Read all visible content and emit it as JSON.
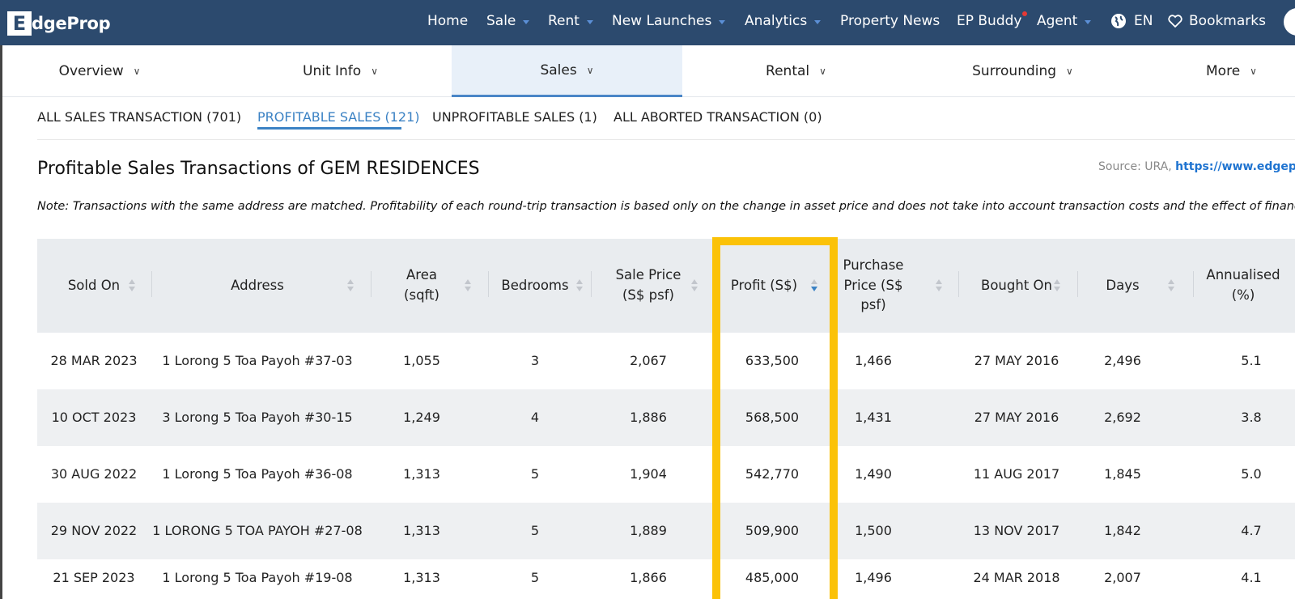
{
  "brand": {
    "logo_letter": "E",
    "logo_text": "dgeProp"
  },
  "topnav": {
    "items": [
      {
        "label": "Home"
      },
      {
        "label": "Sale"
      },
      {
        "label": "Rent"
      },
      {
        "label": "New Launches"
      },
      {
        "label": "Analytics"
      },
      {
        "label": "Property News"
      },
      {
        "label": "EP Buddy"
      },
      {
        "label": "Agent"
      },
      {
        "label": "EN"
      },
      {
        "label": "Bookmarks"
      }
    ]
  },
  "subtabs": [
    {
      "label": "Overview"
    },
    {
      "label": "Unit Info"
    },
    {
      "label": "Sales"
    },
    {
      "label": "Rental"
    },
    {
      "label": "Surrounding"
    },
    {
      "label": "More"
    }
  ],
  "transaction_tabs": [
    {
      "label": "ALL SALES TRANSACTION (701)"
    },
    {
      "label": "PROFITABLE SALES (121)"
    },
    {
      "label": "UNPROFITABLE SALES (1)"
    },
    {
      "label": "ALL ABORTED TRANSACTION (0)"
    }
  ],
  "heading": "Profitable Sales Transactions of GEM RESIDENCES",
  "source": {
    "prefix": "Source: URA,",
    "link": "https://www.edgepro"
  },
  "note": "Note: Transactions with the same address are matched. Profitability of each round-trip transaction is based only on the change in asset price and does not take into account transaction costs and the effect of financing.",
  "table": {
    "columns": [
      "Sold On",
      "Address",
      "Area (sqft)",
      "Bedrooms",
      "Sale Price (S$ psf)",
      "Profit (S$)",
      "Purchase Price (S$ psf)",
      "Bought On",
      "Days",
      "Annualised (%)"
    ],
    "rows": [
      [
        "28 MAR 2023",
        "1 Lorong 5 Toa Payoh #37-03",
        "1,055",
        "3",
        "2,067",
        "633,500",
        "1,466",
        "27 MAY 2016",
        "2,496",
        "5.1"
      ],
      [
        "10 OCT 2023",
        "3 Lorong 5 Toa Payoh #30-15",
        "1,249",
        "4",
        "1,886",
        "568,500",
        "1,431",
        "27 MAY 2016",
        "2,692",
        "3.8"
      ],
      [
        "30 AUG 2022",
        "1 Lorong 5 Toa Payoh #36-08",
        "1,313",
        "5",
        "1,904",
        "542,770",
        "1,490",
        "11 AUG 2017",
        "1,845",
        "5.0"
      ],
      [
        "29 NOV 2022",
        "1 LORONG 5 TOA PAYOH #27-08",
        "1,313",
        "5",
        "1,889",
        "509,900",
        "1,500",
        "13 NOV 2017",
        "1,842",
        "4.7"
      ],
      [
        "21 SEP 2023",
        "1 Lorong 5 Toa Payoh #19-08",
        "1,313",
        "5",
        "1,866",
        "485,000",
        "1,496",
        "24 MAR 2018",
        "2,007",
        "4.1"
      ]
    ]
  },
  "colors": {
    "nav_bg": "#2c4a6e",
    "accent": "#3b82c4",
    "highlight": "#fbc208"
  }
}
